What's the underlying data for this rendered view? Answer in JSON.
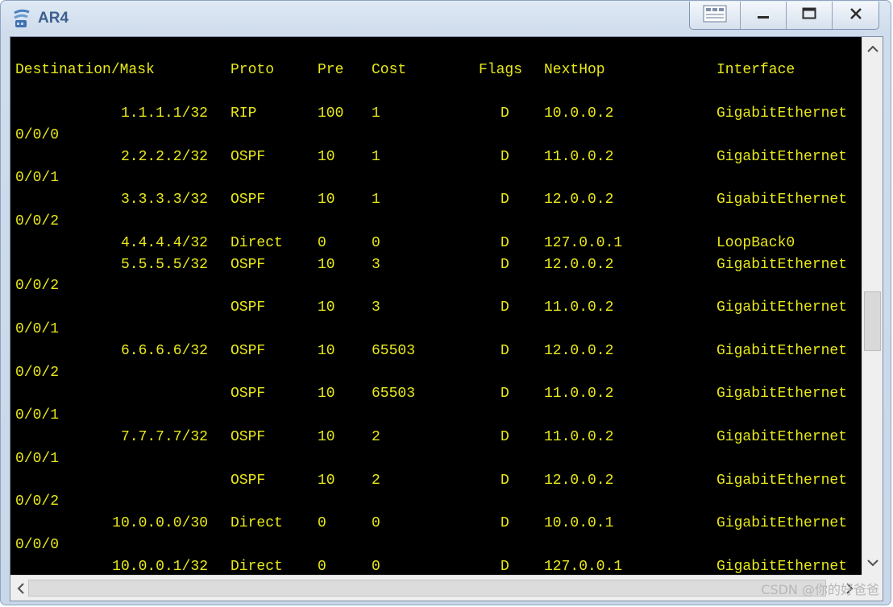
{
  "window": {
    "title": "AR4",
    "controls": [
      "layout-icon",
      "minimize-icon",
      "maximize-icon",
      "close-icon"
    ]
  },
  "terminal": {
    "text_color": "#e8e81a",
    "background": "#000000",
    "header": {
      "destination": "Destination/Mask",
      "proto": "Proto",
      "pre": "Pre",
      "cost": "Cost",
      "flags": "Flags",
      "nexthop": "NextHop",
      "interface": "Interface"
    },
    "routes": [
      {
        "destination": "1.1.1.1/32",
        "proto": "RIP",
        "pre": "100",
        "cost": "1",
        "flags": "D",
        "nexthop": "10.0.0.2",
        "interface": "GigabitEthernet",
        "interface_wrap": "0/0/0"
      },
      {
        "destination": "2.2.2.2/32",
        "proto": "OSPF",
        "pre": "10",
        "cost": "1",
        "flags": "D",
        "nexthop": "11.0.0.2",
        "interface": "GigabitEthernet",
        "interface_wrap": "0/0/1"
      },
      {
        "destination": "3.3.3.3/32",
        "proto": "OSPF",
        "pre": "10",
        "cost": "1",
        "flags": "D",
        "nexthop": "12.0.0.2",
        "interface": "GigabitEthernet",
        "interface_wrap": "0/0/2"
      },
      {
        "destination": "4.4.4.4/32",
        "proto": "Direct",
        "pre": "0",
        "cost": "0",
        "flags": "D",
        "nexthop": "127.0.0.1",
        "interface": "LoopBack0",
        "interface_wrap": ""
      },
      {
        "destination": "5.5.5.5/32",
        "proto": "OSPF",
        "pre": "10",
        "cost": "3",
        "flags": "D",
        "nexthop": "12.0.0.2",
        "interface": "GigabitEthernet",
        "interface_wrap": "0/0/2"
      },
      {
        "destination": "",
        "proto": "OSPF",
        "pre": "10",
        "cost": "3",
        "flags": "D",
        "nexthop": "11.0.0.2",
        "interface": "GigabitEthernet",
        "interface_wrap": "0/0/1"
      },
      {
        "destination": "6.6.6.6/32",
        "proto": "OSPF",
        "pre": "10",
        "cost": "65503",
        "flags": "D",
        "nexthop": "12.0.0.2",
        "interface": "GigabitEthernet",
        "interface_wrap": "0/0/2"
      },
      {
        "destination": "",
        "proto": "OSPF",
        "pre": "10",
        "cost": "65503",
        "flags": "D",
        "nexthop": "11.0.0.2",
        "interface": "GigabitEthernet",
        "interface_wrap": "0/0/1"
      },
      {
        "destination": "7.7.7.7/32",
        "proto": "OSPF",
        "pre": "10",
        "cost": "2",
        "flags": "D",
        "nexthop": "11.0.0.2",
        "interface": "GigabitEthernet",
        "interface_wrap": "0/0/1"
      },
      {
        "destination": "",
        "proto": "OSPF",
        "pre": "10",
        "cost": "2",
        "flags": "D",
        "nexthop": "12.0.0.2",
        "interface": "GigabitEthernet",
        "interface_wrap": "0/0/2"
      },
      {
        "destination": "10.0.0.0/30",
        "proto": "Direct",
        "pre": "0",
        "cost": "0",
        "flags": "D",
        "nexthop": "10.0.0.1",
        "interface": "GigabitEthernet",
        "interface_wrap": "0/0/0"
      },
      {
        "destination": "10.0.0.1/32",
        "proto": "Direct",
        "pre": "0",
        "cost": "0",
        "flags": "D",
        "nexthop": "127.0.0.1",
        "interface": "GigabitEthernet",
        "interface_wrap": ""
      }
    ]
  },
  "scrollbars": {
    "vertical": {
      "up": "chevron-up-icon",
      "down": "chevron-down-icon"
    },
    "horizontal": {
      "left": "chevron-left-icon",
      "right": "chevron-right-icon"
    }
  },
  "watermark": "CSDN @你的好爸爸"
}
